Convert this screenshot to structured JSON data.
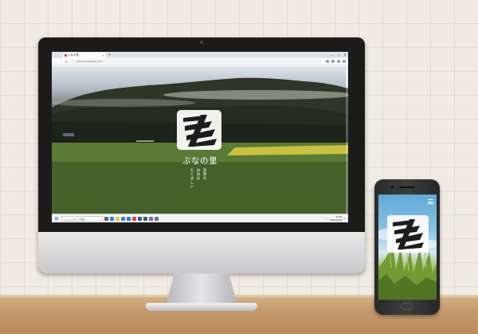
{
  "browser": {
    "tab_title": "ぶなの里",
    "tab_close": "×",
    "new_tab": "+",
    "window_controls": [
      "—",
      "□",
      "✕"
    ],
    "url": "https://bunanosato.com/"
  },
  "site": {
    "brand_name": "ぶなの里",
    "tagline_lines": [
      "高原の",
      "お米は",
      "たくましい"
    ]
  },
  "taskbar": {
    "start_icon": "windows-start-icon",
    "search_placeholder": "ここに入力して検索",
    "time": "14:05",
    "date": "2021/04/20",
    "app_icons": [
      "task-view-icon",
      "edge-icon",
      "explorer-icon",
      "store-icon",
      "mail-icon",
      "chrome-icon",
      "word-icon",
      "excel-icon",
      "photos-icon",
      "settings-icon"
    ]
  },
  "colors": {
    "wall": "#f0ebe3",
    "desk": "#c49a6a",
    "bezel": "#1b1b1b",
    "logo_dark": "#1d1d1d",
    "logo_bg": "#ffffff"
  }
}
